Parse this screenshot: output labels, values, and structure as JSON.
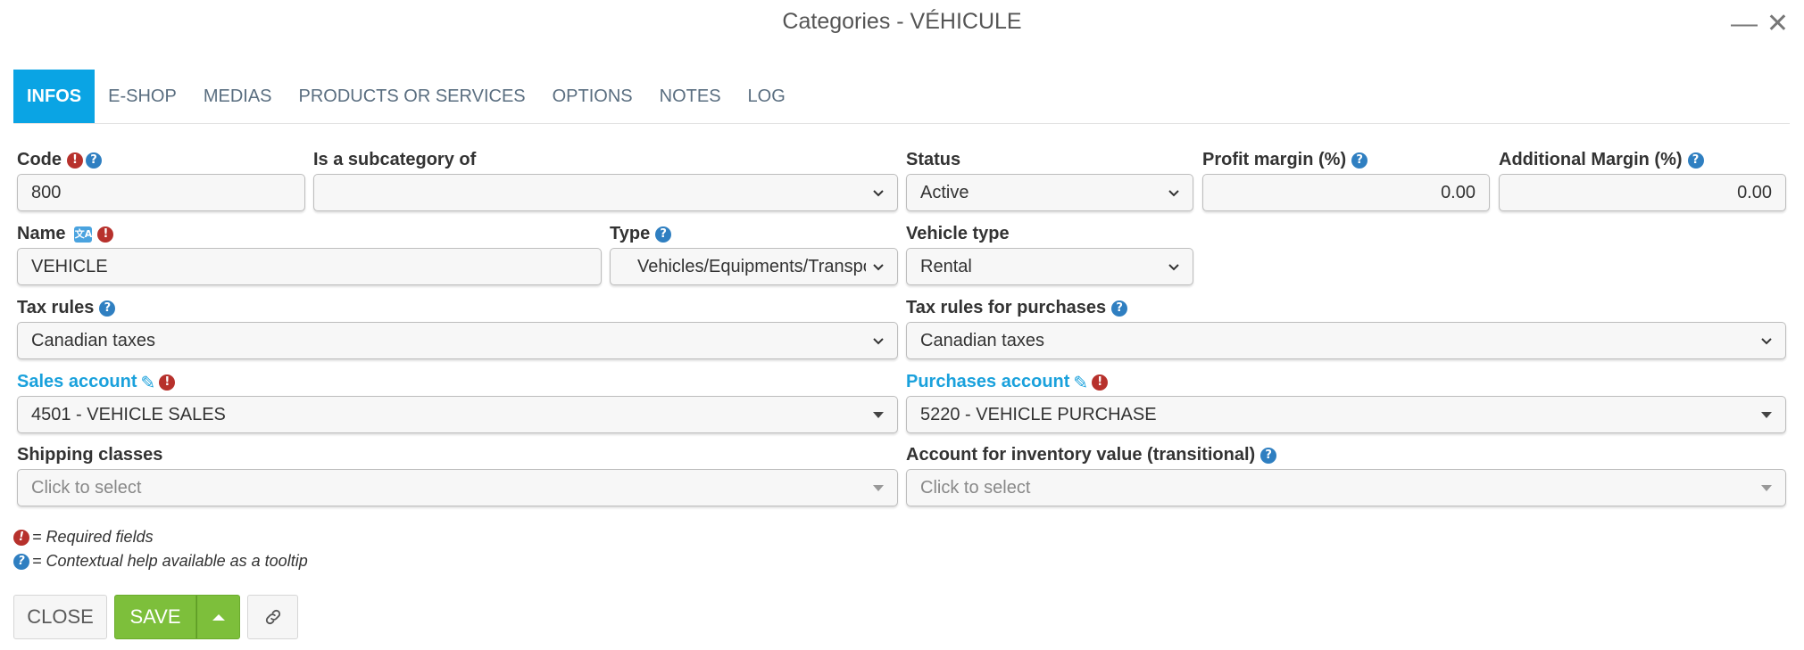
{
  "window": {
    "title": "Categories - VÉHICULE",
    "minimize_glyph": "—",
    "close_glyph": "✕"
  },
  "tabs": [
    {
      "label": "INFOS",
      "active": true
    },
    {
      "label": "E-SHOP"
    },
    {
      "label": "MEDIAS"
    },
    {
      "label": "PRODUCTS OR SERVICES"
    },
    {
      "label": "OPTIONS"
    },
    {
      "label": "NOTES"
    },
    {
      "label": "LOG"
    }
  ],
  "form": {
    "code": {
      "label": "Code",
      "value": "800"
    },
    "subcategory": {
      "label": "Is a subcategory of",
      "value": ""
    },
    "status": {
      "label": "Status",
      "value": "Active"
    },
    "profit_margin": {
      "label": "Profit margin (%)",
      "value": "0.00"
    },
    "additional_margin": {
      "label": "Additional Margin (%)",
      "value": "0.00"
    },
    "name": {
      "label": "Name",
      "value": "VEHICLE"
    },
    "type": {
      "label": "Type",
      "value": "Vehicles/Equipments/Transport"
    },
    "vehicle_type": {
      "label": "Vehicle type",
      "value": "Rental"
    },
    "tax_rules": {
      "label": "Tax rules",
      "value": "Canadian taxes"
    },
    "tax_rules_purchases": {
      "label": "Tax rules for purchases",
      "value": "Canadian taxes"
    },
    "sales_account": {
      "label": "Sales account",
      "value": "4501 - VEHICLE SALES"
    },
    "purchases_account": {
      "label": "Purchases account",
      "value": "5220 - VEHICLE PURCHASE"
    },
    "shipping_classes": {
      "label": "Shipping classes",
      "placeholder": "Click to select"
    },
    "inventory_account": {
      "label": "Account for inventory value (transitional)",
      "placeholder": "Click to select"
    }
  },
  "legend": {
    "required": "= Required fields",
    "help": "= Contextual help available as a tooltip"
  },
  "buttons": {
    "close": "CLOSE",
    "save": "SAVE"
  },
  "colors": {
    "accent": "#0aa4e4",
    "save_green": "#7dbf3b",
    "help_blue": "#2f7fc1",
    "required_red": "#b7312c",
    "link_blue": "#1aa1dc"
  }
}
